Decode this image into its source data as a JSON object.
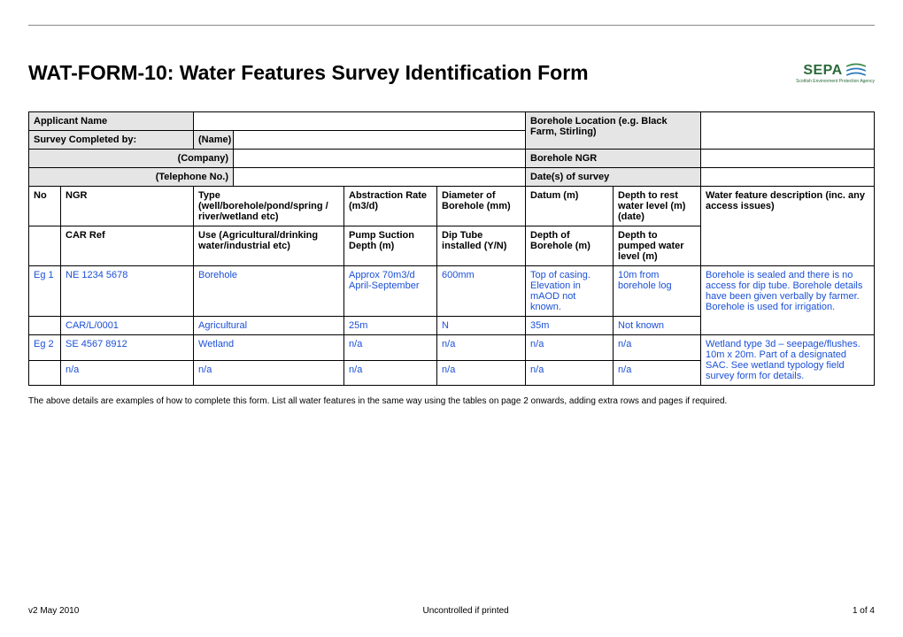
{
  "title": "WAT-FORM-10: Water Features Survey Identification Form",
  "logo": {
    "text": "SEPA",
    "sub": "Scottish Environment\nProtection Agency"
  },
  "labels": {
    "applicant": "Applicant Name",
    "survey_by": "Survey Completed by:",
    "name": "(Name)",
    "company": "(Company)",
    "telephone": "(Telephone No.)",
    "bh_location": "Borehole Location (e.g. Black Farm, Stirling)",
    "bh_ngr": "Borehole NGR",
    "dates": "Date(s) of survey"
  },
  "headers": {
    "no": "No",
    "ngr": "NGR",
    "type": "Type (well/borehole/pond/spring / river/wetland etc)",
    "abstraction": "Abstraction Rate (m3/d)",
    "diameter": "Diameter of Borehole (mm)",
    "datum": "Datum (m)",
    "depth_rest": "Depth to rest water level (m) (date)",
    "description": "Water feature description (inc. any access issues)",
    "car_ref": "CAR Ref",
    "use": "Use (Agricultural/drinking water/industrial etc)",
    "pump": "Pump Suction Depth (m)",
    "dip": "Dip Tube installed (Y/N)",
    "depth_bh": "Depth of Borehole (m)",
    "depth_pump": "Depth to pumped water level (m)"
  },
  "examples": [
    {
      "no": "Eg 1",
      "ngr": "NE 1234 5678",
      "type": "Borehole",
      "abstraction": "Approx 70m3/d April-September",
      "diameter": "600mm",
      "datum": "Top of casing. Elevation in mAOD not known.",
      "depth_rest": "10m from borehole log",
      "description": "Borehole is sealed and there is no access for dip tube. Borehole details have been given verbally by farmer. Borehole is used for irrigation.",
      "car_ref": "CAR/L/0001",
      "use": "Agricultural",
      "pump": "25m",
      "dip": "N",
      "depth_bh": "35m",
      "depth_pump": "Not known"
    },
    {
      "no": "Eg 2",
      "ngr": "SE 4567 8912",
      "type": "Wetland",
      "abstraction": "n/a",
      "diameter": "n/a",
      "datum": "n/a",
      "depth_rest": "n/a",
      "description": "Wetland type 3d – seepage/flushes. 10m x 20m. Part of a designated SAC. See wetland typology field survey form for details.",
      "car_ref": "n/a",
      "use": "n/a",
      "pump": "n/a",
      "dip": "n/a",
      "depth_bh": "n/a",
      "depth_pump": "n/a"
    }
  ],
  "note": "The above details are examples of how to complete this form. List all water features in the same way using the tables on page 2 onwards, adding extra rows and pages if required.",
  "footer": {
    "left": "v2  May 2010",
    "center": "Uncontrolled if printed",
    "right": "1 of 4"
  }
}
